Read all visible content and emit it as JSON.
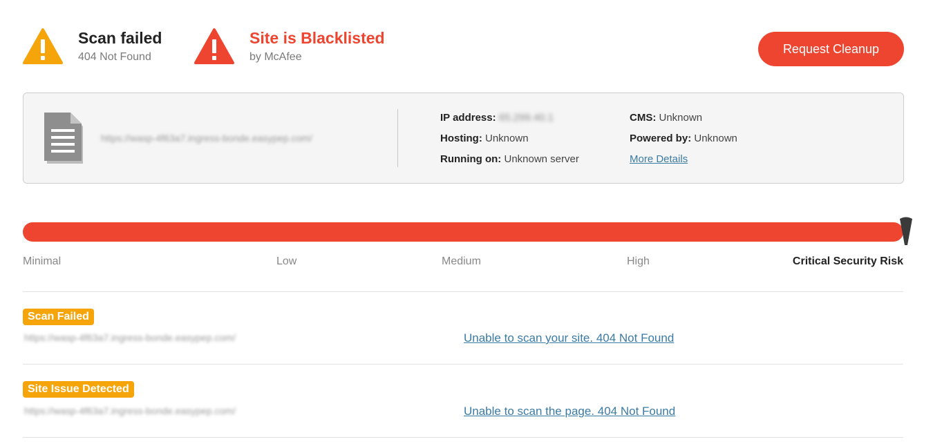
{
  "header": {
    "scan": {
      "title": "Scan failed",
      "subtitle": "404 Not Found",
      "color": "#f5a40a",
      "icon": "warning-triangle-icon"
    },
    "blacklist": {
      "title": "Site is Blacklisted",
      "subtitle": "by McAfee",
      "color": "#ee4530",
      "icon": "warning-triangle-icon"
    },
    "request_cleanup_label": "Request Cleanup",
    "button_color": "#ee4530"
  },
  "site": {
    "icon": "document-icon",
    "url": "https://wasp-4f63a7.ingress-bonde.easypep.com/",
    "ip_label": "IP address:",
    "ip_value": "65.299.40.1",
    "hosting_label": "Hosting:",
    "hosting_value": "Unknown",
    "running_label": "Running on:",
    "running_value": "Unknown server",
    "cms_label": "CMS:",
    "cms_value": "Unknown",
    "powered_label": "Powered by:",
    "powered_value": "Unknown",
    "more_details": "More Details"
  },
  "risk": {
    "levels": [
      "Minimal",
      "Low",
      "Medium",
      "High",
      "Critical Security Risk"
    ],
    "current_level": "Critical Security Risk",
    "fill_fraction": 1.0,
    "bar_color": "#ee4530",
    "marker_icon": "risk-needle-icon"
  },
  "issues": [
    {
      "badge": "Scan Failed",
      "url": "https://wasp-4f63a7.ingress-bonde.easypep.com/",
      "message": "Unable to scan your site. 404 Not Found"
    },
    {
      "badge": "Site Issue Detected",
      "url": "https://wasp-4f63a7.ingress-bonde.easypep.com/",
      "message": "Unable to scan the page. 404 Not Found"
    }
  ],
  "badge_color": "#f5a40a"
}
